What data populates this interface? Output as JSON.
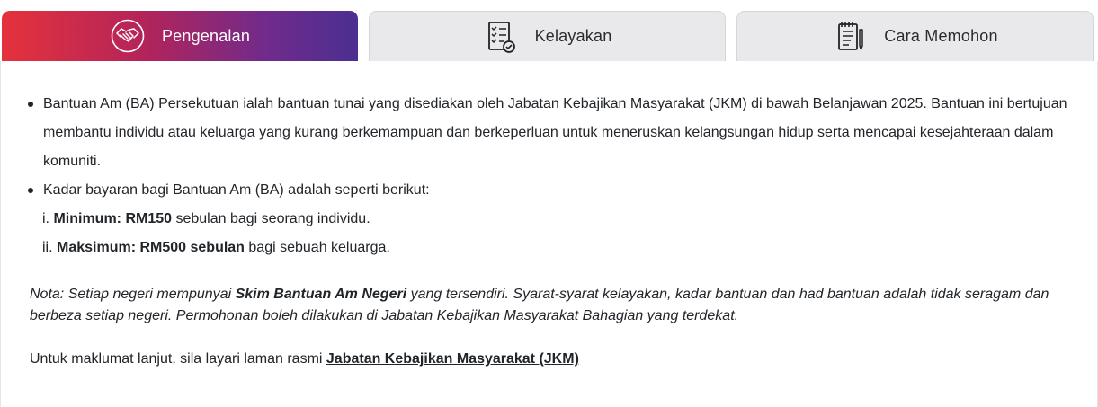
{
  "tabs": [
    {
      "label": "Pengenalan",
      "icon": "handshake-icon",
      "active": true
    },
    {
      "label": "Kelayakan",
      "icon": "checklist-icon",
      "active": false
    },
    {
      "label": "Cara Memohon",
      "icon": "application-form-icon",
      "active": false
    }
  ],
  "colors": {
    "active_gradient_start": "#e5323c",
    "active_gradient_end": "#4b2f91",
    "inactive_tab": "#e9e9ec"
  },
  "content": {
    "bullet1": "Bantuan Am (BA) Persekutuan ialah bantuan tunai yang disediakan oleh Jabatan Kebajikan Masyarakat (JKM) di bawah Belanjawan 2025. Bantuan ini bertujuan membantu individu atau keluarga yang kurang berkemampuan dan berkeperluan untuk meneruskan kelangsungan hidup serta mencapai kesejahteraan dalam komuniti.",
    "bullet2": "Kadar bayaran bagi Bantuan Am (BA) adalah seperti berikut:",
    "rate_min": {
      "prefix": "i. ",
      "bold": "Minimum: RM150",
      "rest": " sebulan bagi seorang individu."
    },
    "rate_max": {
      "prefix": "ii. ",
      "bold": "Maksimum: RM500 sebulan",
      "rest": " bagi sebuah keluarga."
    },
    "note": {
      "prefix": "Nota: Setiap negeri mempunyai ",
      "bold": "Skim Bantuan Am Negeri",
      "rest": " yang tersendiri. Syarat-syarat kelayakan, kadar bantuan dan had bantuan adalah tidak seragam dan berbeza setiap negeri. Permohonan boleh dilakukan di Jabatan Kebajikan Masyarakat Bahagian yang terdekat."
    },
    "more_info": {
      "text": "Untuk maklumat lanjut, sila layari laman rasmi ",
      "link": "Jabatan Kebajikan Masyarakat (JKM) "
    }
  }
}
